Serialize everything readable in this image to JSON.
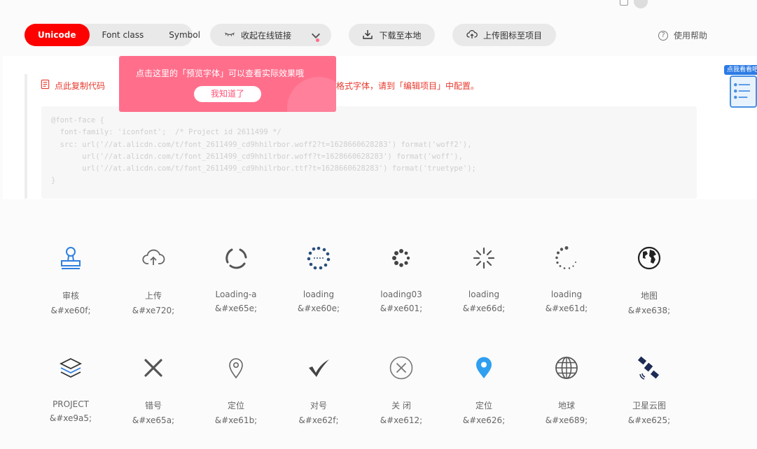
{
  "tabs": [
    {
      "label": "Unicode",
      "active": true
    },
    {
      "label": "Font class",
      "active": false
    },
    {
      "label": "Symbol",
      "active": false
    }
  ],
  "toolbar": {
    "collapse_label": "收起在线链接",
    "download_label": "下载至本地",
    "upload_label": "上传图标至项目",
    "help_label": "使用帮助"
  },
  "code_panel": {
    "copy_label": "点此复制代码",
    "config_tip": "格式字体，请到「编辑项目」中配置。",
    "code_lines": [
      "@font-face {",
      "  font-family: 'iconfont';  /* Project id 2611499 */",
      "  src: url('//at.alicdn.com/t/font_2611499_cd9hhilrbor.woff2?t=1628660628283') format('woff2'),",
      "       url('//at.alicdn.com/t/font_2611499_cd9hhilrbor.woff?t=1628660628283') format('woff'),",
      "       url('//at.alicdn.com/t/font_2611499_cd9hhilrbor.ttf?t=1628660628283') format('truetype');",
      "}"
    ]
  },
  "popover": {
    "message": "点击这里的「预览字体」可以查看实际效果哦",
    "ok_label": "我知道了"
  },
  "float_badge": {
    "label": "点我看看吧"
  },
  "colors": {
    "accent": "#ff0000",
    "popover": "#ff6f8c",
    "link_red": "#e83a2e",
    "icon_blue": "#2f7fe0",
    "icon_gray": "#666666",
    "icon_dark": "#3a3a3a"
  },
  "icons": [
    {
      "name": "审核",
      "code": "&#xe60f;",
      "icon": "audit-stamp-icon"
    },
    {
      "name": "上传",
      "code": "&#xe720;",
      "icon": "cloud-upload-icon"
    },
    {
      "name": "Loading-a",
      "code": "&#xe65e;",
      "icon": "loading-arc-icon"
    },
    {
      "name": "loading",
      "code": "&#xe60e;",
      "icon": "loading-ring-icon"
    },
    {
      "name": "loading03",
      "code": "&#xe601;",
      "icon": "loading-dots-icon"
    },
    {
      "name": "loading",
      "code": "&#xe66d;",
      "icon": "loading-spokes-icon"
    },
    {
      "name": "loading",
      "code": "&#xe61d;",
      "icon": "loading-dot-circle-icon"
    },
    {
      "name": "地图",
      "code": "&#xe638;",
      "icon": "globe-map-icon"
    },
    {
      "name": "PROJECT",
      "code": "&#xe9a5;",
      "icon": "layers-icon"
    },
    {
      "name": "错号",
      "code": "&#xe65a;",
      "icon": "cross-icon"
    },
    {
      "name": "定位",
      "code": "&#xe61b;",
      "icon": "location-outline-icon"
    },
    {
      "name": "对号",
      "code": "&#xe62f;",
      "icon": "checkmark-icon"
    },
    {
      "name": "关 闭",
      "code": "&#xe612;",
      "icon": "close-circle-icon"
    },
    {
      "name": "定位",
      "code": "&#xe626;",
      "icon": "location-filled-icon"
    },
    {
      "name": "地球",
      "code": "&#xe689;",
      "icon": "earth-icon"
    },
    {
      "name": "卫星云图",
      "code": "&#xe625;",
      "icon": "satellite-icon"
    }
  ]
}
